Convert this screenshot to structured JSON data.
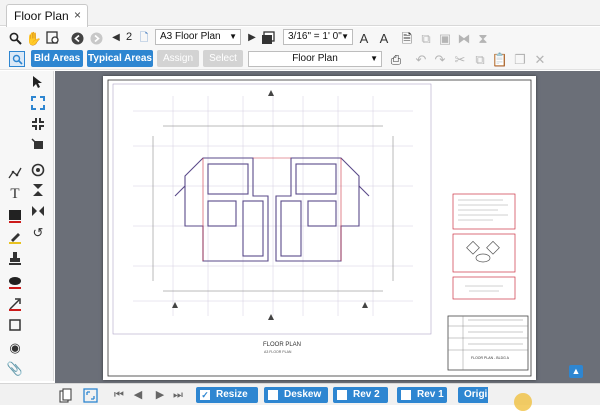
{
  "tab": {
    "title": "Floor Plan",
    "close": "×"
  },
  "toolbar": {
    "page_number": "2",
    "sheet_select": "A3 Floor Plan",
    "scale_select": "3/16\" = 1' 0\"",
    "view_select": "Floor Plan",
    "bld_areas": "Bld Areas",
    "typical_areas": "Typical Areas",
    "assign": "Assign",
    "select": "Select"
  },
  "drawing": {
    "plan_title": "FLOOR PLAN",
    "plan_subtitle": "A3 FLOOR PLAN",
    "titleblock_label": "FLOOR PLAN - BLDG A"
  },
  "bottom": {
    "resize": "Resize",
    "deskew": "Deskew",
    "rev2": "Rev 2",
    "rev1": "Rev 1",
    "original": "Original"
  },
  "colors": {
    "accent": "#2e86d1",
    "canvas": "#6b6f78",
    "plan_line": "#5a4a8a",
    "red_line": "#cc3344"
  }
}
